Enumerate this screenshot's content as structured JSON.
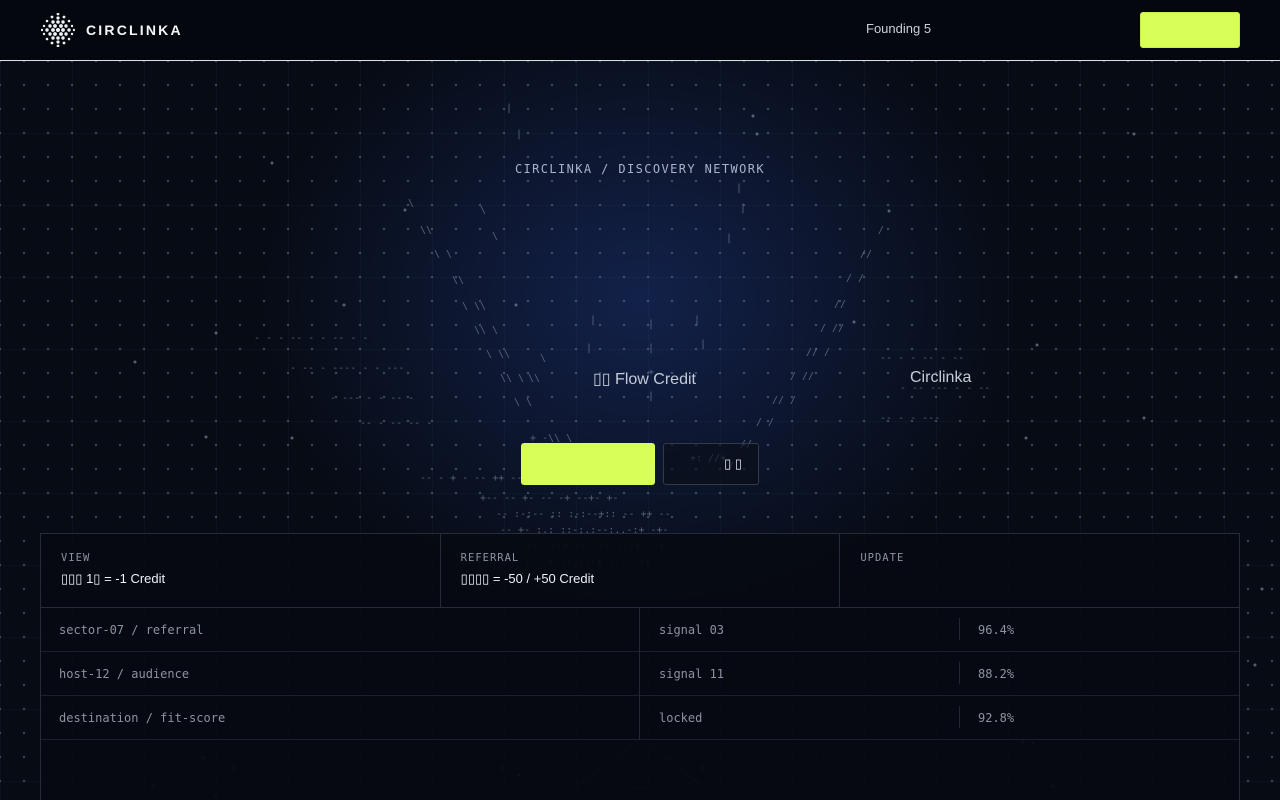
{
  "header": {
    "brand": "CIRCLINKA",
    "nav_link": "Founding 5",
    "cta_label": ""
  },
  "hero": {
    "eyebrow": "CIRCLINKA / DISCOVERY NETWORK",
    "line_left": "▯▯ Flow Credit",
    "line_right": "Circlinka",
    "primary_label": "",
    "secondary_label": "▯ ▯"
  },
  "stats": [
    {
      "label": "VIEW",
      "value": "▯▯▯ 1▯ = -1 Credit"
    },
    {
      "label": "REFERRAL",
      "value": "▯▯▯▯ = -50 / +50 Credit"
    },
    {
      "label": "UPDATE",
      "value": ""
    }
  ],
  "rows": [
    {
      "name": "sector-07 / referral",
      "signal": "signal 03",
      "score": "96.4%"
    },
    {
      "name": "host-12 / audience",
      "signal": "signal 11",
      "score": "88.2%"
    },
    {
      "name": "destination / fit-score",
      "signal": "locked",
      "score": "92.8%"
    }
  ],
  "colors": {
    "accent": "#d8ff57",
    "background": "#070b14",
    "border": "#252c39"
  },
  "icons": {
    "logo": "dotted-sphere-icon"
  }
}
